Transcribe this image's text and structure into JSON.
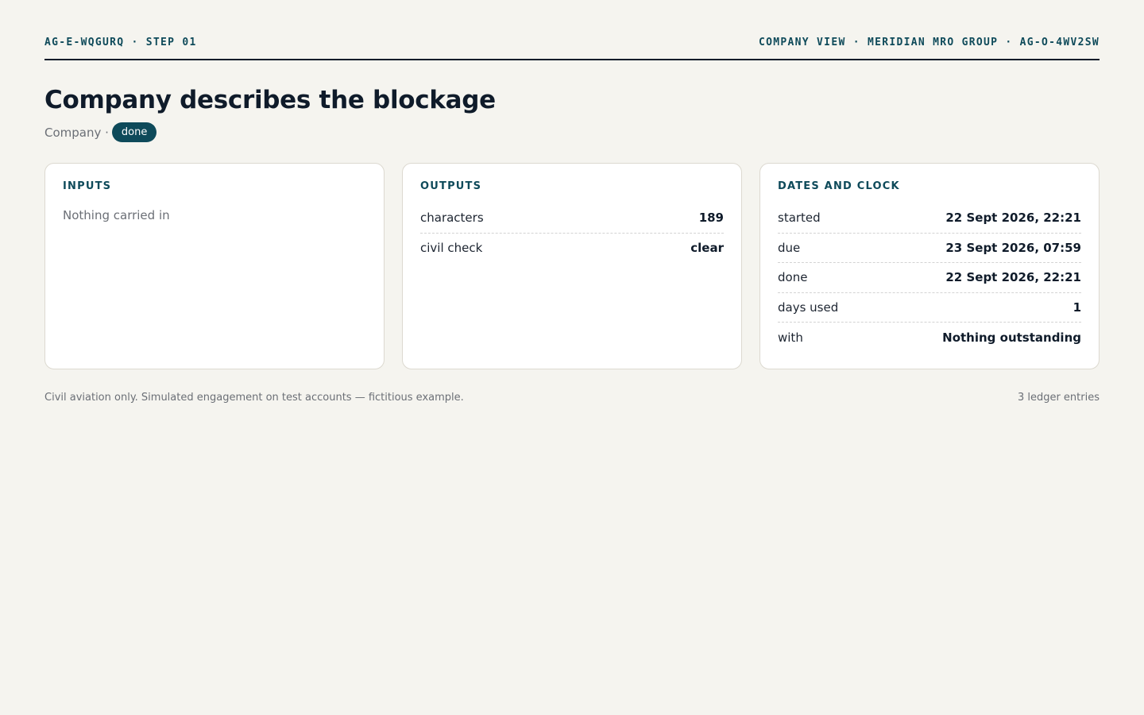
{
  "header": {
    "left": "AG-E-WQGURQ · STEP 01",
    "right": "COMPANY VIEW · MERIDIAN MRO GROUP · AG-O-4WV2SW"
  },
  "title": "Company describes the blockage",
  "subline": {
    "role": "Company ·",
    "status": "done"
  },
  "inputs": {
    "title": "INPUTS",
    "empty": "Nothing carried in"
  },
  "outputs": {
    "title": "OUTPUTS",
    "rows": [
      {
        "label": "characters",
        "value": "189"
      },
      {
        "label": "civil check",
        "value": "clear"
      }
    ]
  },
  "dates": {
    "title": "DATES AND CLOCK",
    "rows": [
      {
        "label": "started",
        "value": "22 Sept 2026, 22:21"
      },
      {
        "label": "due",
        "value": "23 Sept 2026, 07:59"
      },
      {
        "label": "done",
        "value": "22 Sept 2026, 22:21"
      },
      {
        "label": "days used",
        "value": "1"
      },
      {
        "label": "with",
        "value": "Nothing outstanding"
      }
    ]
  },
  "footer": {
    "left": "Civil aviation only. Simulated engagement on test accounts — fictitious example.",
    "right": "3 ledger entries"
  },
  "colors": {
    "background": "#f5f4ef",
    "accent": "#0e4a5a",
    "text": "#0f1b2a",
    "muted": "#6b6f76"
  }
}
